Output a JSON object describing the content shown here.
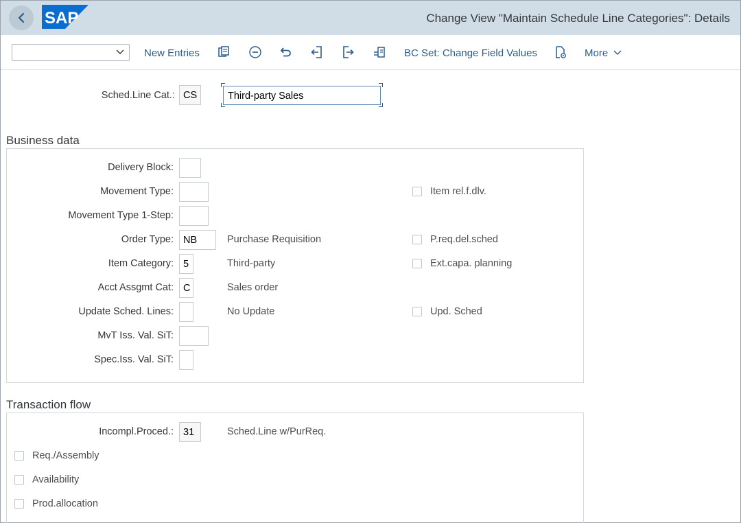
{
  "header": {
    "title": "Change View \"Maintain Schedule Line Categories\": Details",
    "logo_text": "SAP"
  },
  "toolbar": {
    "select_value": "",
    "new_entries": "New Entries",
    "bc_set": "BC Set: Change Field Values",
    "more": "More"
  },
  "top": {
    "sched_label": "Sched.Line Cat.:",
    "sched_value": "CS",
    "sched_desc": "Third-party Sales"
  },
  "business": {
    "title": "Business data",
    "delivery_block_label": "Delivery Block:",
    "delivery_block_value": "",
    "movement_type_label": "Movement Type:",
    "movement_type_value": "",
    "movement_1step_label": "Movement Type 1-Step:",
    "movement_1step_value": "",
    "order_type_label": "Order Type:",
    "order_type_value": "NB",
    "order_type_desc": "Purchase Requisition",
    "item_category_label": "Item Category:",
    "item_category_value": "5",
    "item_category_desc": "Third-party",
    "acct_label": "Acct Assgmt Cat:",
    "acct_value": "C",
    "acct_desc": "Sales order",
    "update_label": "Update Sched. Lines:",
    "update_value": "",
    "update_desc": "No Update",
    "mvt_iss_label": "MvT Iss. Val. SiT:",
    "mvt_iss_value": "",
    "spec_iss_label": "Spec.Iss. Val. SiT:",
    "spec_iss_value": "",
    "cb_item_rel": "Item rel.f.dlv.",
    "cb_preq": "P.req.del.sched",
    "cb_ext": "Ext.capa. planning",
    "cb_upd": "Upd. Sched"
  },
  "transaction": {
    "title": "Transaction flow",
    "incompl_label": "Incompl.Proced.:",
    "incompl_value": "31",
    "incompl_desc": "Sched.Line w/PurReq.",
    "cb_req": "Req./Assembly",
    "cb_avail": "Availability",
    "cb_prod": "Prod.allocation"
  },
  "colors": {
    "header_bg": "#d1dde6",
    "link_blue": "#2a5c8c",
    "logo_blue": "#0a6ed1"
  },
  "icons": [
    "back-icon",
    "sap-logo",
    "chevron-down-icon",
    "details-icon",
    "delete-icon",
    "undo-icon",
    "previous-entry-icon",
    "next-entry-icon",
    "select-all-icon",
    "bc-set-icon"
  ]
}
